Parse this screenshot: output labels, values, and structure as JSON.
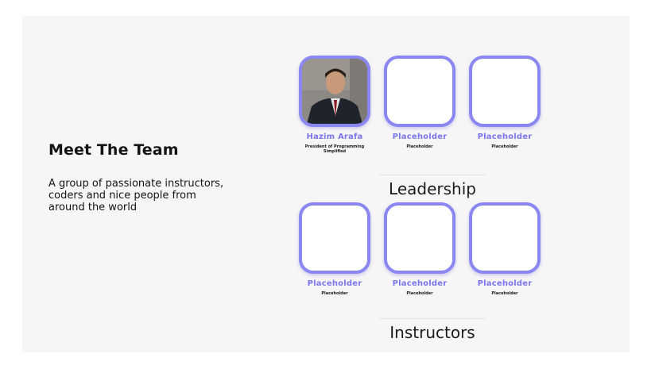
{
  "intro": {
    "title": "Meet The Team",
    "subtitle": "A group of passionate instructors, coders and nice people from around the world"
  },
  "leadership": {
    "title": "Leadership",
    "members": [
      {
        "name": "Hazim Arafa",
        "role": "President of Programming Simplified",
        "photo": "portrait-photo"
      },
      {
        "name": "Placeholder",
        "role": "Placeholder"
      },
      {
        "name": "Placeholder",
        "role": "Placeholder"
      }
    ]
  },
  "instructors": {
    "title": "Instructors",
    "members": [
      {
        "name": "Placeholder",
        "role": "Placeholder"
      },
      {
        "name": "Placeholder",
        "role": "Placeholder"
      },
      {
        "name": "Placeholder",
        "role": "Placeholder"
      }
    ]
  },
  "colors": {
    "accent": "#8a86f2",
    "name_text": "#7b76ee",
    "panel_bg": "#f6f6f6"
  }
}
